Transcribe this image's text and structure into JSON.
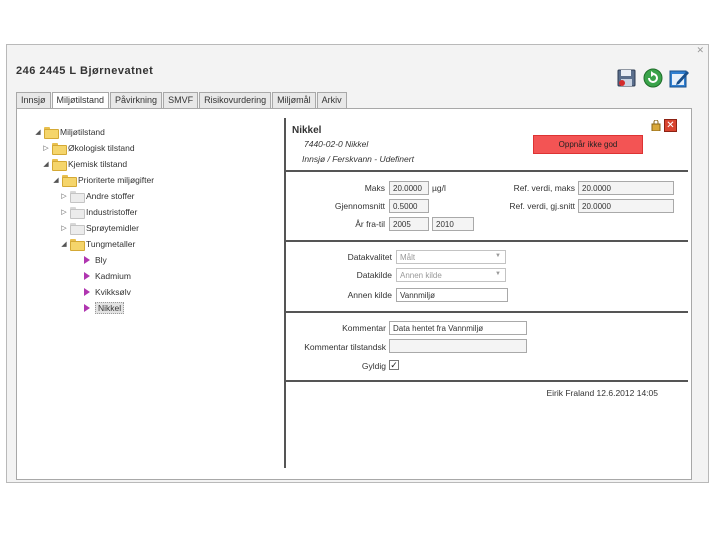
{
  "window": {
    "title": "246  2445  L Bjørnevatnet",
    "close_glyph": "✕"
  },
  "toolbar": [
    {
      "name": "save-icon"
    },
    {
      "name": "refresh-icon"
    },
    {
      "name": "edit-icon"
    }
  ],
  "tabs": [
    {
      "label": "Innsjø",
      "active": false
    },
    {
      "label": "Miljøtilstand",
      "active": true
    },
    {
      "label": "Påvirkning",
      "active": false
    },
    {
      "label": "SMVF",
      "active": false
    },
    {
      "label": "Risikovurdering",
      "active": false
    },
    {
      "label": "Miljømål",
      "active": false
    },
    {
      "label": "Arkiv",
      "active": false
    }
  ],
  "tree": [
    {
      "label": "Miljøtilstand",
      "level": 0,
      "arrow": "◢",
      "icon": "folder"
    },
    {
      "label": "Økologisk tilstand",
      "level": 1,
      "arrow": "▷",
      "icon": "folder"
    },
    {
      "label": "Kjemisk tilstand",
      "level": 1,
      "arrow": "◢",
      "icon": "folder"
    },
    {
      "label": "Prioriterte miljøgifter",
      "level": 2,
      "arrow": "◢",
      "icon": "folder"
    },
    {
      "label": "Andre stoffer",
      "level": 3,
      "arrow": "▷",
      "icon": "folder-grey"
    },
    {
      "label": "Industristoffer",
      "level": 3,
      "arrow": "▷",
      "icon": "folder-grey"
    },
    {
      "label": "Sprøytemidler",
      "level": 3,
      "arrow": "▷",
      "icon": "folder-grey"
    },
    {
      "label": "Tungmetaller",
      "level": 3,
      "arrow": "◢",
      "icon": "folder"
    },
    {
      "label": "Bly",
      "level": 4,
      "arrow": "",
      "icon": "leaf"
    },
    {
      "label": "Kadmium",
      "level": 4,
      "arrow": "",
      "icon": "leaf"
    },
    {
      "label": "Kvikksølv",
      "level": 4,
      "arrow": "",
      "icon": "leaf"
    },
    {
      "label": "Nikkel",
      "level": 4,
      "arrow": "",
      "icon": "leaf",
      "selected": true
    }
  ],
  "detail": {
    "heading": "Nikkel",
    "code": "7440-02-0 Nikkel",
    "subtitle": "Innsjø / Ferskvann - Udefinert",
    "status": "Oppnår ikke god",
    "status_color": "#f35454",
    "maks_label": "Maks",
    "maks_value": "20.0000",
    "unit": "µg/l",
    "gjennomsnitt_label": "Gjennomsnitt",
    "gjennomsnitt_value": "0.5000",
    "aar_label": "År fra-til",
    "aar_fra": "2005",
    "aar_til": "2010",
    "ref_maks_label": "Ref. verdi, maks",
    "ref_maks_value": "20.0000",
    "ref_gj_label": "Ref. verdi, gj.snitt",
    "ref_gj_value": "20.0000",
    "datakvalitet_label": "Datakvalitet",
    "datakvalitet_value": "Målt",
    "datakilde_label": "Datakilde",
    "datakilde_value": "Annen kilde",
    "annen_kilde_label": "Annen kilde",
    "annen_kilde_value": "Vannmiljø",
    "kommentar_label": "Kommentar",
    "kommentar_value": "Data hentet fra Vannmiljø",
    "kommentar_tilstand_label": "Kommentar tilstandsk",
    "kommentar_tilstand_value": "",
    "gyldig_label": "Gyldig",
    "gyldig_checked": "✓",
    "footer": "Eirik Fraland 12.6.2012 14:05"
  }
}
